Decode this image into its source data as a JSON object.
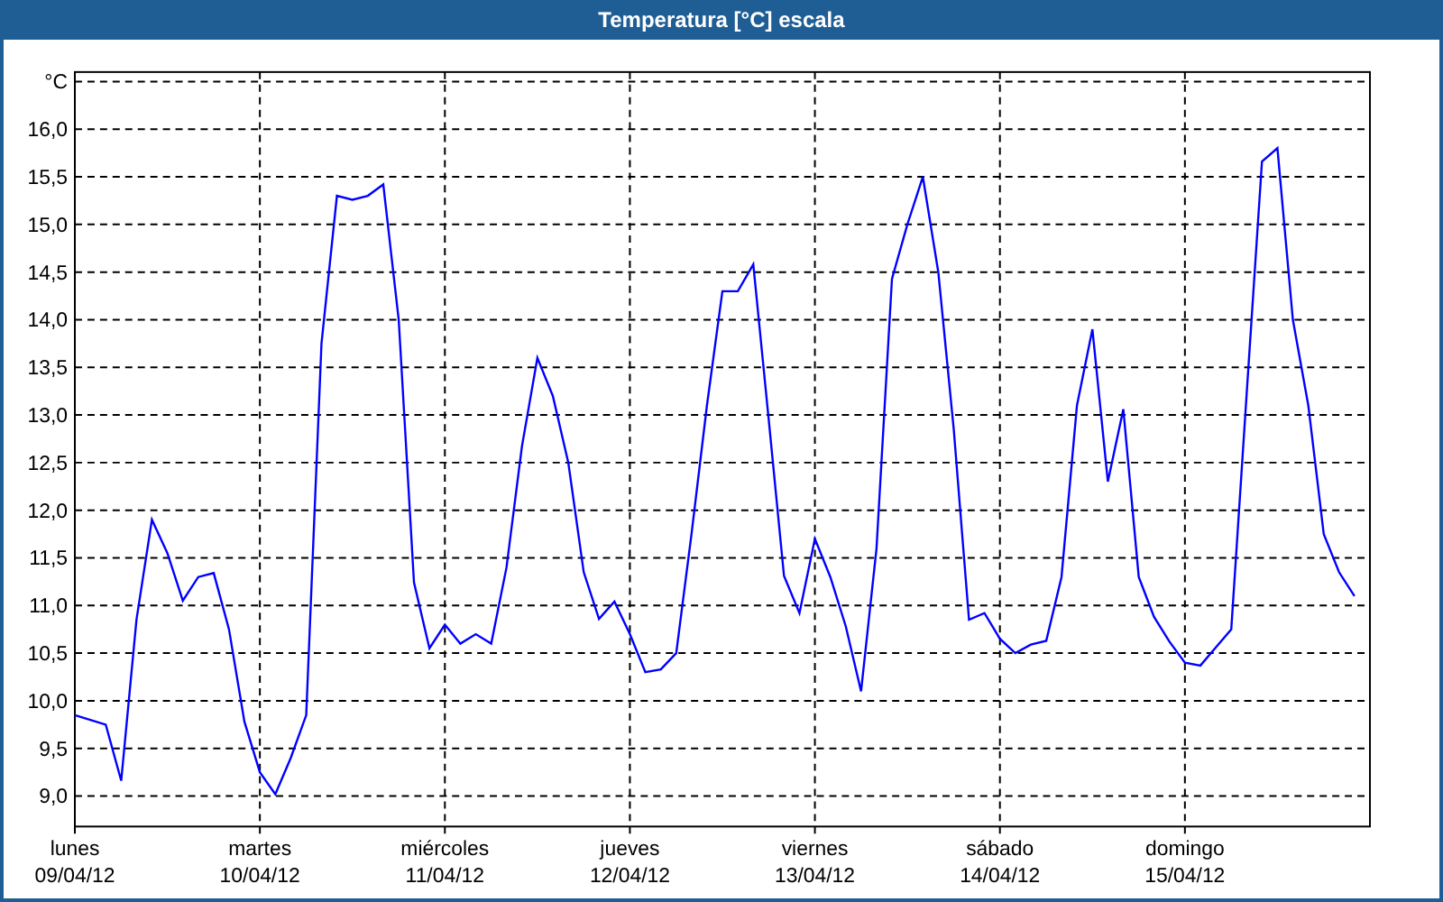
{
  "window": {
    "title": "Temperatura [°C] escala"
  },
  "chart": {
    "chart_data": {
      "type": "line",
      "grid": true,
      "ylim": [
        8.68,
        16.6
      ],
      "yticks": [
        {
          "value": 9,
          "label": "9,0"
        },
        {
          "value": 9.5,
          "label": "9,5"
        },
        {
          "value": 10,
          "label": "10,0"
        },
        {
          "value": 10.5,
          "label": "10,5"
        },
        {
          "value": 11,
          "label": "11,0"
        },
        {
          "value": 11.5,
          "label": "11,5"
        },
        {
          "value": 12,
          "label": "12,0"
        },
        {
          "value": 12.5,
          "label": "12,5"
        },
        {
          "value": 13,
          "label": "13,0"
        },
        {
          "value": 13.5,
          "label": "13,5"
        },
        {
          "value": 14,
          "label": "14,0"
        },
        {
          "value": 14.5,
          "label": "14,5"
        },
        {
          "value": 15,
          "label": "15,0"
        },
        {
          "value": 15.5,
          "label": "15,5"
        },
        {
          "value": 16,
          "label": "16,0"
        },
        {
          "value": 16.5,
          "label": "°C"
        }
      ],
      "categories": [
        "lunes\n09/04/12",
        null,
        null,
        null,
        null,
        null,
        null,
        null,
        null,
        null,
        null,
        null,
        "martes\n10/04/12",
        null,
        null,
        null,
        null,
        null,
        null,
        null,
        null,
        null,
        null,
        null,
        "miércoles\n11/04/12",
        null,
        null,
        null,
        null,
        null,
        null,
        null,
        null,
        null,
        null,
        null,
        "jueves\n12/04/12",
        null,
        null,
        null,
        null,
        null,
        null,
        null,
        null,
        null,
        null,
        null,
        "viernes\n13/04/12",
        null,
        null,
        null,
        null,
        null,
        null,
        null,
        null,
        null,
        null,
        null,
        "sábado\n14/04/12",
        null,
        null,
        null,
        null,
        null,
        null,
        null,
        null,
        null,
        null,
        null,
        "domingo\n15/04/12",
        null,
        null,
        null,
        null,
        null,
        null,
        null,
        null,
        null,
        null,
        null,
        null
      ],
      "series": [
        {
          "color": "#0000ff",
          "values": [
            9.85,
            9.8,
            9.75,
            9.16,
            10.85,
            11.9,
            11.55,
            11.05,
            11.3,
            11.34,
            10.75,
            9.78,
            9.25,
            9.02,
            9.4,
            9.85,
            13.75,
            15.3,
            15.26,
            15.3,
            15.42,
            14.0,
            11.24,
            10.55,
            10.8,
            10.6,
            10.7,
            10.6,
            11.4,
            12.67,
            13.6,
            13.2,
            12.5,
            11.35,
            10.86,
            11.04,
            10.7,
            10.3,
            10.33,
            10.5,
            11.75,
            13.1,
            14.3,
            14.3,
            14.58,
            12.95,
            11.31,
            10.92,
            11.7,
            11.3,
            10.78,
            10.1,
            11.6,
            14.43,
            15.0,
            15.5,
            14.5,
            12.85,
            10.85,
            10.92,
            10.65,
            10.5,
            10.59,
            10.63,
            11.3,
            13.1,
            13.9,
            12.3,
            13.06,
            11.3,
            10.88,
            10.62,
            10.4,
            10.37,
            10.56,
            10.75,
            13.2,
            15.66,
            15.8,
            14.0,
            13.1,
            11.75,
            11.35,
            11.1,
            null
          ]
        }
      ]
    }
  }
}
